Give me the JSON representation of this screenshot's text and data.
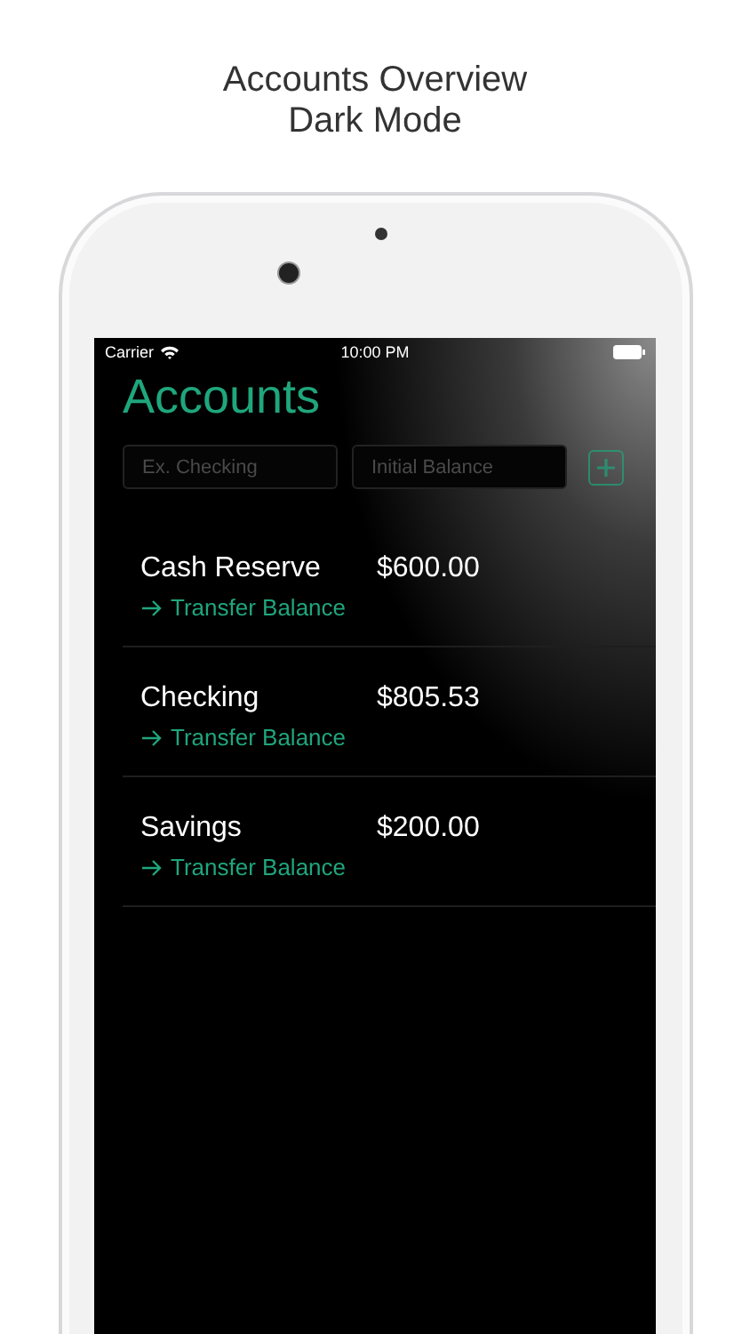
{
  "caption": [
    "Accounts Overview",
    "Dark Mode"
  ],
  "status_bar": {
    "carrier": "Carrier",
    "time": "10:00 PM"
  },
  "title": "Accounts",
  "form": {
    "fields": [
      {
        "placeholder": "Ex. Checking"
      },
      {
        "placeholder": "Initial Balance"
      }
    ]
  },
  "accounts": [
    {
      "name": "Cash Reserve",
      "balance": "$600.00",
      "action": "Transfer Balance"
    },
    {
      "name": "Checking",
      "balance": "$805.53",
      "action": "Transfer Balance"
    },
    {
      "name": "Savings",
      "balance": "$200.00",
      "action": "Transfer Balance"
    }
  ]
}
